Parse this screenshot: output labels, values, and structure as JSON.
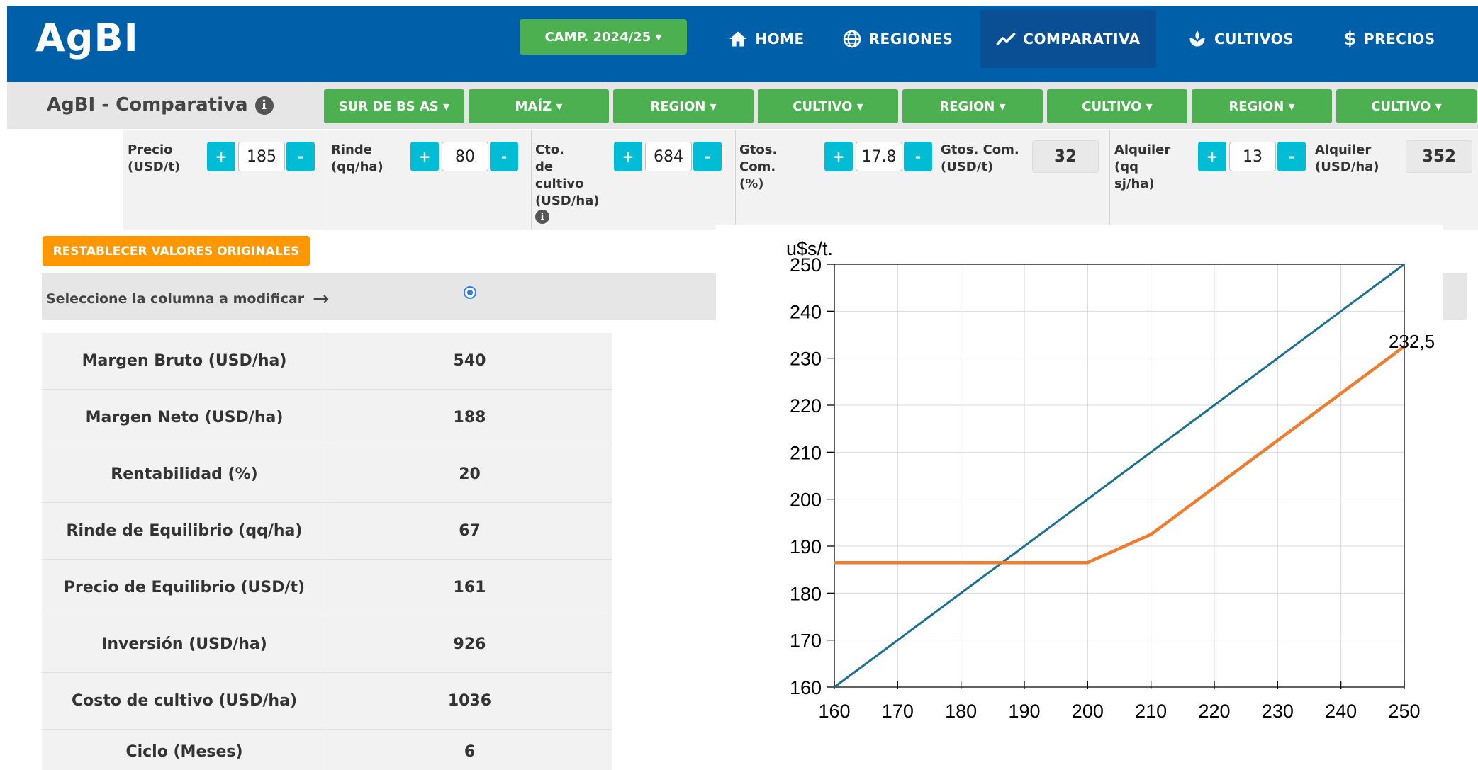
{
  "app": {
    "logo": "AgBI"
  },
  "navbar": {
    "campaign": "CAMP. 2024/25 ▾",
    "items": [
      {
        "label": "HOME",
        "icon": "home-icon"
      },
      {
        "label": "REGIONES",
        "icon": "globe-icon"
      },
      {
        "label": "COMPARATIVA",
        "icon": "trend-icon",
        "active": true
      },
      {
        "label": "CULTIVOS",
        "icon": "plant-icon"
      },
      {
        "label": "PRECIOS",
        "icon": "dollar-icon"
      }
    ]
  },
  "subbar": {
    "title": "AgBI - Comparativa",
    "info": "i",
    "filters": [
      "SUR DE BS AS ▾",
      "MAÍZ ▾",
      "REGION ▾",
      "CULTIVO ▾",
      "REGION ▾",
      "CULTIVO ▾",
      "REGION ▾",
      "CULTIVO ▾"
    ]
  },
  "params": {
    "precio": {
      "label_1": "Precio",
      "label_2": "(USD/t)",
      "value": "185"
    },
    "rinde": {
      "label_1": "Rinde",
      "label_2": "(qq/ha)",
      "value": "80"
    },
    "costo": {
      "label_1": "Cto.",
      "label_2": "de",
      "label_3": "cultivo",
      "label_4": "(USD/ha)",
      "value": "684"
    },
    "gtos_com_pct": {
      "label_1": "Gtos.",
      "label_2": "Com.",
      "label_3": "(%)",
      "value": "17.8"
    },
    "gtos_com_usd": {
      "label_1": "Gtos. Com.",
      "label_2": "(USD/t)",
      "value": "32"
    },
    "alquiler_qq": {
      "label_1": "Alquiler",
      "label_2": "(qq",
      "label_3": "sj/ha)",
      "value": "13"
    },
    "alquiler_usd": {
      "label_1": "Alquiler",
      "label_2": "(USD/ha)",
      "value": "352"
    },
    "plus": "+",
    "minus": "-"
  },
  "reset_label": "RESTABLECER VALORES ORIGINALES",
  "select_label": "Seleccione la columna a modificar",
  "select_arrow": "→",
  "results": [
    {
      "label": "Margen Bruto (USD/ha)",
      "value": "540"
    },
    {
      "label": "Margen Neto (USD/ha)",
      "value": "188"
    },
    {
      "label": "Rentabilidad (%)",
      "value": "20"
    },
    {
      "label": "Rinde de Equilibrio (qq/ha)",
      "value": "67"
    },
    {
      "label": "Precio de Equilibrio (USD/t)",
      "value": "161"
    },
    {
      "label": "Inversión (USD/ha)",
      "value": "926"
    },
    {
      "label": "Costo de cultivo (USD/ha)",
      "value": "1036"
    },
    {
      "label": "Ciclo (Meses)",
      "value": "6"
    }
  ],
  "chart_data": {
    "type": "line",
    "ylabel": "u$s/t.",
    "xlabel": "",
    "xlim": [
      160,
      250
    ],
    "ylim": [
      160,
      250
    ],
    "xticks": [
      160,
      170,
      180,
      190,
      200,
      210,
      220,
      230,
      240,
      250
    ],
    "yticks": [
      160,
      170,
      180,
      190,
      200,
      210,
      220,
      230,
      240,
      250
    ],
    "grid": true,
    "series": [
      {
        "color": "#1a6f93",
        "x": [
          160,
          250
        ],
        "y": [
          160,
          250
        ]
      },
      {
        "color": "#ed7d31",
        "x": [
          160,
          200,
          210,
          250
        ],
        "y": [
          186.5,
          186.5,
          192.5,
          232.5
        ]
      }
    ],
    "annotation": {
      "text": "232,5",
      "x": 250,
      "y": 232.5
    }
  }
}
